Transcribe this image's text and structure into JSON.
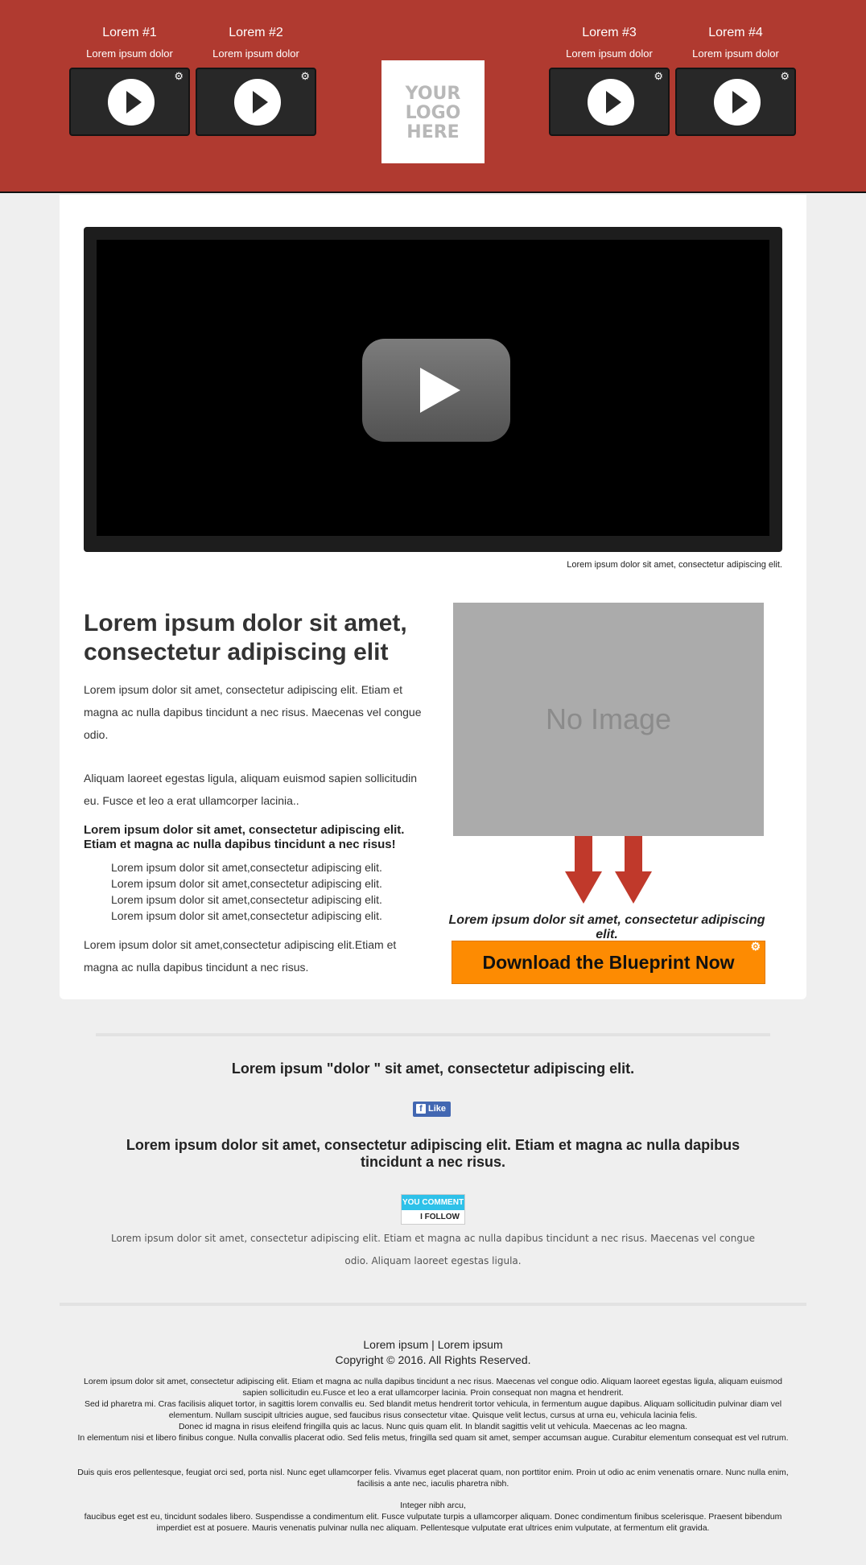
{
  "header": {
    "videos": [
      {
        "title": "Lorem #1",
        "subtitle": "Lorem ipsum dolor"
      },
      {
        "title": "Lorem #2",
        "subtitle": "Lorem ipsum dolor"
      },
      {
        "title": "Lorem #3",
        "subtitle": "Lorem ipsum dolor"
      },
      {
        "title": "Lorem #4",
        "subtitle": "Lorem ipsum dolor"
      }
    ],
    "logo_lines": [
      "YOUR",
      "LOGO",
      "HERE"
    ],
    "gear_icon": "settings-gear-icon",
    "bg_color": "#b03a30"
  },
  "video": {
    "caption": "Lorem ipsum dolor sit amet, consectetur adipiscing elit.",
    "play_icon": "youtube-play-icon"
  },
  "content": {
    "heading": "Lorem ipsum dolor sit amet, consectetur adipiscing elit",
    "para1": "Lorem ipsum dolor sit amet, consectetur adipiscing elit. Etiam et magna ac nulla dapibus tincidunt a nec risus. Maecenas vel congue odio.",
    "para2": "Aliquam laoreet egestas ligula, aliquam euismod sapien sollicitudin eu. Fusce et leo a erat ullamcorper lacinia..",
    "bold_line": "Lorem ipsum dolor sit amet, consectetur adipiscing elit. Etiam et magna ac nulla dapibus tincidunt a nec risus!",
    "list": [
      "Lorem ipsum dolor sit amet,consectetur adipiscing elit.",
      "Lorem ipsum dolor sit amet,consectetur adipiscing elit.",
      "Lorem ipsum dolor sit amet,consectetur adipiscing elit.",
      "Lorem ipsum dolor sit amet,consectetur adipiscing elit."
    ],
    "para3": "Lorem ipsum dolor sit amet,consectetur adipiscing elit.Etiam et magna ac nulla dapibus tincidunt a nec risus.",
    "image_placeholder": "No Image",
    "cta_text": "Lorem ipsum dolor sit amet, consectetur adipiscing elit.",
    "download_button": "Download the Blueprint Now",
    "accent_color": "#fd8b02",
    "arrow_color": "#c0392b"
  },
  "social": {
    "quote": "Lorem ipsum \"dolor \" sit amet, consectetur adipiscing elit.",
    "like_label": "Like",
    "headline": "Lorem ipsum dolor sit amet, consectetur adipiscing elit. Etiam et magna ac nulla dapibus tincidunt a nec risus.",
    "badge_top": "YOU COMMENT",
    "badge_bottom": "I FOLLOW",
    "small_text": "Lorem ipsum dolor sit amet, consectetur adipiscing elit. Etiam et magna ac nulla dapibus tincidunt a nec risus. Maecenas vel congue odio. Aliquam laoreet egestas ligula."
  },
  "footer": {
    "links": "Lorem ipsum | Lorem ipsum",
    "copyright": "Copyright © 2016. All Rights Reserved.",
    "block1": [
      "Lorem ipsum dolor sit amet, consectetur adipiscing elit. Etiam et magna ac nulla dapibus tincidunt a nec risus. Maecenas vel congue odio. Aliquam laoreet egestas ligula, aliquam euismod sapien sollicitudin eu.Fusce et leo a erat ullamcorper lacinia. Proin consequat non magna et hendrerit.",
      "Sed id pharetra mi. Cras facilisis aliquet tortor, in sagittis lorem convallis eu. Sed blandit metus hendrerit tortor vehicula, in fermentum augue dapibus. Aliquam sollicitudin pulvinar diam vel elementum. Nullam suscipit ultricies augue, sed faucibus risus consectetur vitae. Quisque velit lectus, cursus at urna eu, vehicula lacinia felis.",
      "Donec id magna in risus eleifend fringilla quis ac lacus. Nunc quis quam elit. In blandit sagittis velit ut vehicula. Maecenas ac leo magna.",
      "In elementum nisi et libero finibus congue. Nulla convallis placerat odio. Sed felis metus, fringilla sed quam sit amet, semper accumsan augue. Curabitur elementum consequat est vel rutrum."
    ],
    "block2": "Duis quis eros pellentesque, feugiat orci sed, porta nisl. Nunc eget ullamcorper felis. Vivamus eget placerat quam, non porttitor enim. Proin ut odio ac enim venenatis ornare. Nunc nulla enim, facilisis a ante nec, iaculis pharetra nibh.",
    "block3_title": "Integer nibh arcu,",
    "block3": "faucibus eget est eu, tincidunt sodales libero. Suspendisse a condimentum elit. Fusce vulputate turpis a ullamcorper aliquam. Donec condimentum finibus scelerisque. Praesent bibendum imperdiet est at posuere. Mauris venenatis pulvinar nulla nec aliquam. Pellentesque vulputate erat ultrices enim vulputate, at fermentum elit gravida."
  }
}
